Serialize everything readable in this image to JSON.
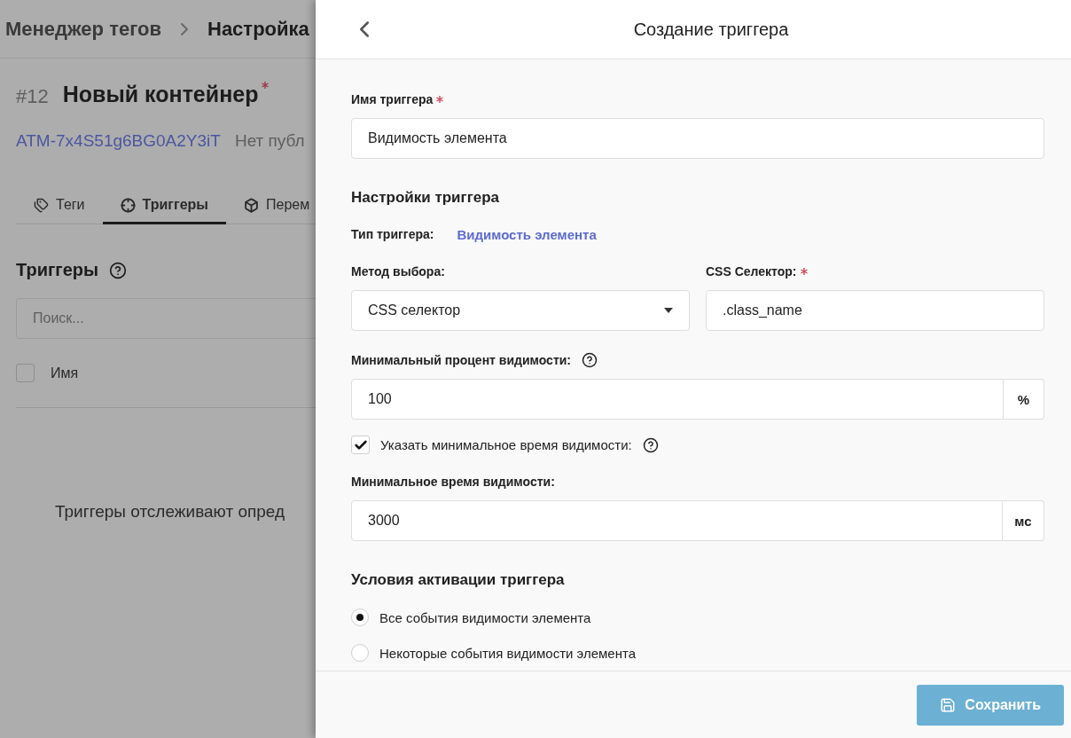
{
  "breadcrumb": [
    {
      "label": "Менеджер тегов"
    },
    {
      "label": "Настройка"
    }
  ],
  "container": {
    "number": "#12",
    "name": "Новый контейнер",
    "required": true,
    "id_link": "ATM-7x4S51g6BG0A2Y3iT",
    "status": "Нет публ"
  },
  "tabs": [
    {
      "label": "Теги",
      "kind": "tags",
      "selected": false
    },
    {
      "label": "Триггеры",
      "kind": "triggers",
      "selected": true
    },
    {
      "label": "Перем",
      "kind": "variables",
      "selected": false
    }
  ],
  "section": {
    "title": "Триггеры"
  },
  "search": {
    "placeholder": "Поиск..."
  },
  "table": {
    "select_all_checked": false,
    "columns": [
      {
        "label": "Имя"
      }
    ]
  },
  "empty_text": "Триггеры отслеживают опред",
  "dialog": {
    "title": "Создание триггера",
    "name_field": {
      "label": "Имя триггера",
      "required": true,
      "value": "Видимость элемента"
    },
    "settings_title": "Настройки триггера",
    "trigger_type": {
      "label": "Тип триггера:",
      "value": "Видимость элемента"
    },
    "method": {
      "label": "Метод выбора:",
      "value": "CSS селектор"
    },
    "selector": {
      "label": "CSS Селектор:",
      "required": true,
      "value": ".class_name"
    },
    "min_percent": {
      "label": "Минимальный процент видимости:",
      "value": "100",
      "unit": "%"
    },
    "min_time_toggle": {
      "label": "Указать минимальное время видимости:",
      "checked": true
    },
    "min_time": {
      "label": "Минимальное время видимости:",
      "value": "3000",
      "unit": "мс"
    },
    "conditions": {
      "title": "Условия активации триггера",
      "options": [
        {
          "label": "Все события видимости элемента",
          "selected": true
        },
        {
          "label": "Некоторые события видимости элемента",
          "selected": false
        }
      ]
    },
    "save_button": "Сохранить"
  }
}
